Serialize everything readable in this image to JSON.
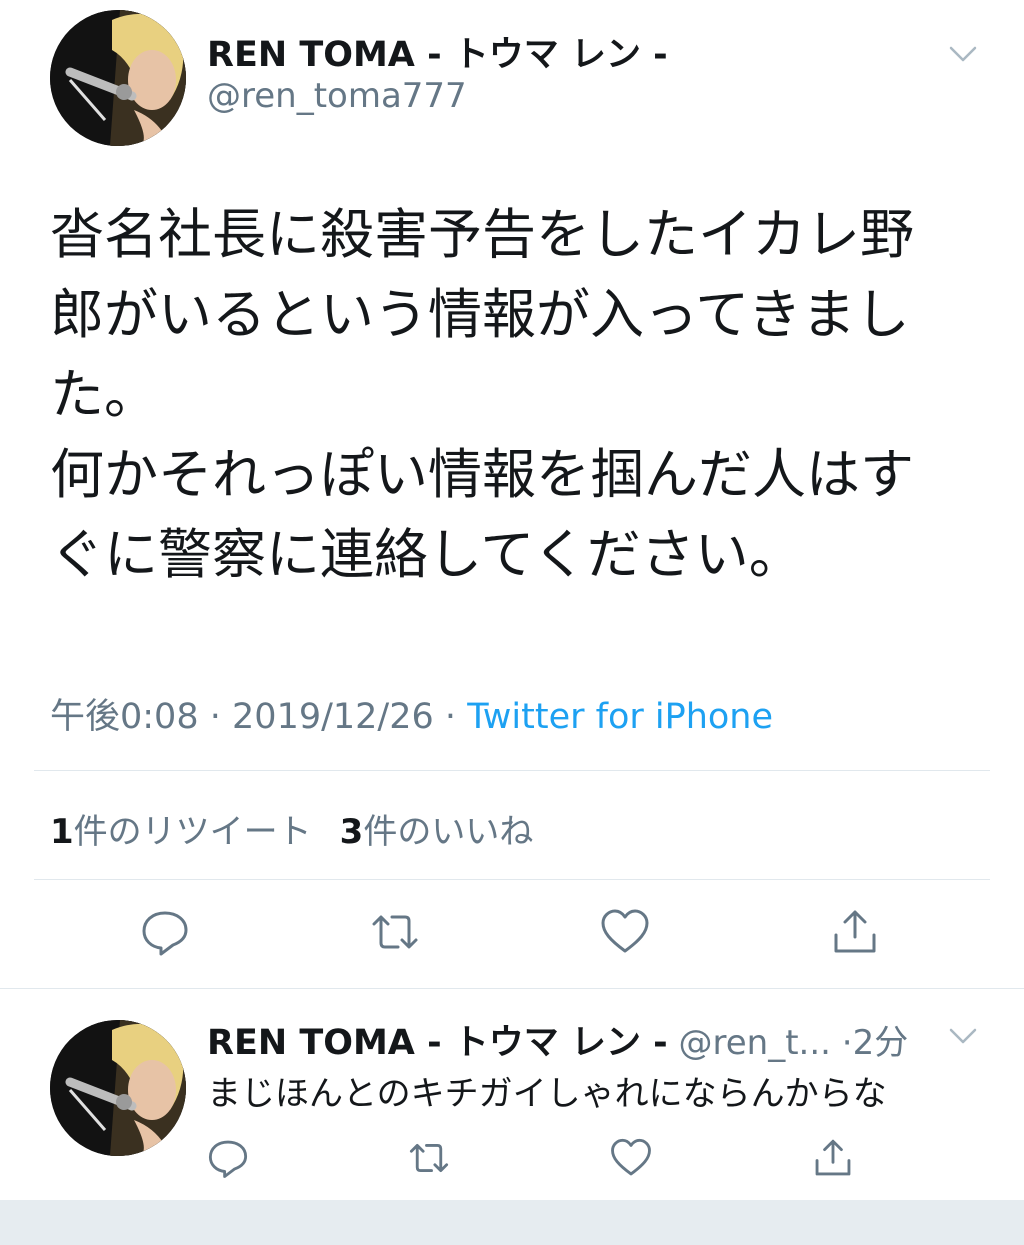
{
  "tweet": {
    "display_name": "REN TOMA - トウマ レン -",
    "handle": "@ren_toma777",
    "text": "沓名社長に殺害予告をしたイカレ野\n郎がいるという情報が入ってきまし\nた。\n何かそれっぽい情報を掴んだ人はす\nぐに警察に連絡してください。",
    "time": "午後0:08",
    "separator": "·",
    "date": "2019/12/26",
    "source": "Twitter for iPhone",
    "retweet_count": "1",
    "retweet_label": "件のリツイート",
    "like_count": "3",
    "like_label": "件のいいね"
  },
  "reply": {
    "display_name": "REN TOMA - トウマ レン -",
    "handle": "@ren_t...",
    "time": "·2分",
    "text": "まじほんとのキチガイしゃれにならんからな"
  },
  "icons": {
    "menu": "chevron-down-icon",
    "reply": "reply-icon",
    "retweet": "retweet-icon",
    "like": "heart-icon",
    "share": "share-icon"
  },
  "colors": {
    "accent": "#1da1f2",
    "secondary_text": "#657786",
    "primary_text": "#14171a",
    "divider": "#e1e8ed"
  }
}
